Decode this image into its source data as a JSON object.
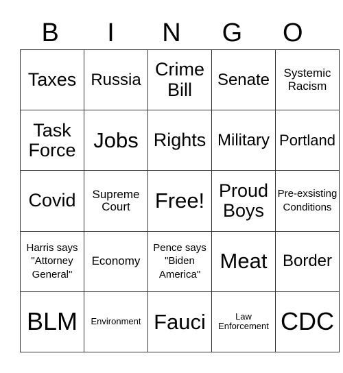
{
  "header": [
    "B",
    "I",
    "N",
    "G",
    "O"
  ],
  "rows": [
    [
      {
        "text": "Taxes",
        "size": "s-m"
      },
      {
        "text": "Russia",
        "size": "s-ml"
      },
      {
        "text": "Crime Bill",
        "size": "s-m"
      },
      {
        "text": "Senate",
        "size": "s-ml"
      },
      {
        "text": "Systemic Racism",
        "size": "s-s"
      }
    ],
    [
      {
        "text": "Task Force",
        "size": "s-m"
      },
      {
        "text": "Jobs",
        "size": "s-l"
      },
      {
        "text": "Rights",
        "size": "s-m"
      },
      {
        "text": "Military",
        "size": "s-ml"
      },
      {
        "text": "Portland",
        "size": "s-sm"
      }
    ],
    [
      {
        "text": "Covid",
        "size": "s-m"
      },
      {
        "text": "Supreme Court",
        "size": "s-s"
      },
      {
        "text": "Free!",
        "size": "s-l"
      },
      {
        "text": "Proud Boys",
        "size": "s-m"
      },
      {
        "text": "Pre-exsisting Conditions",
        "size": "s-xs"
      }
    ],
    [
      {
        "text": "Harris says \"Attorney General\"",
        "size": "s-xs"
      },
      {
        "text": "Economy",
        "size": "s-s"
      },
      {
        "text": "Pence says \"Biden America\"",
        "size": "s-xs"
      },
      {
        "text": "Meat",
        "size": "s-l"
      },
      {
        "text": "Border",
        "size": "s-ml"
      }
    ],
    [
      {
        "text": "BLM",
        "size": "s-xl"
      },
      {
        "text": "Environment",
        "size": "s-xxs"
      },
      {
        "text": "Fauci",
        "size": "s-l"
      },
      {
        "text": "Law Enforcement",
        "size": "s-xxs"
      },
      {
        "text": "CDC",
        "size": "s-xl"
      }
    ]
  ]
}
